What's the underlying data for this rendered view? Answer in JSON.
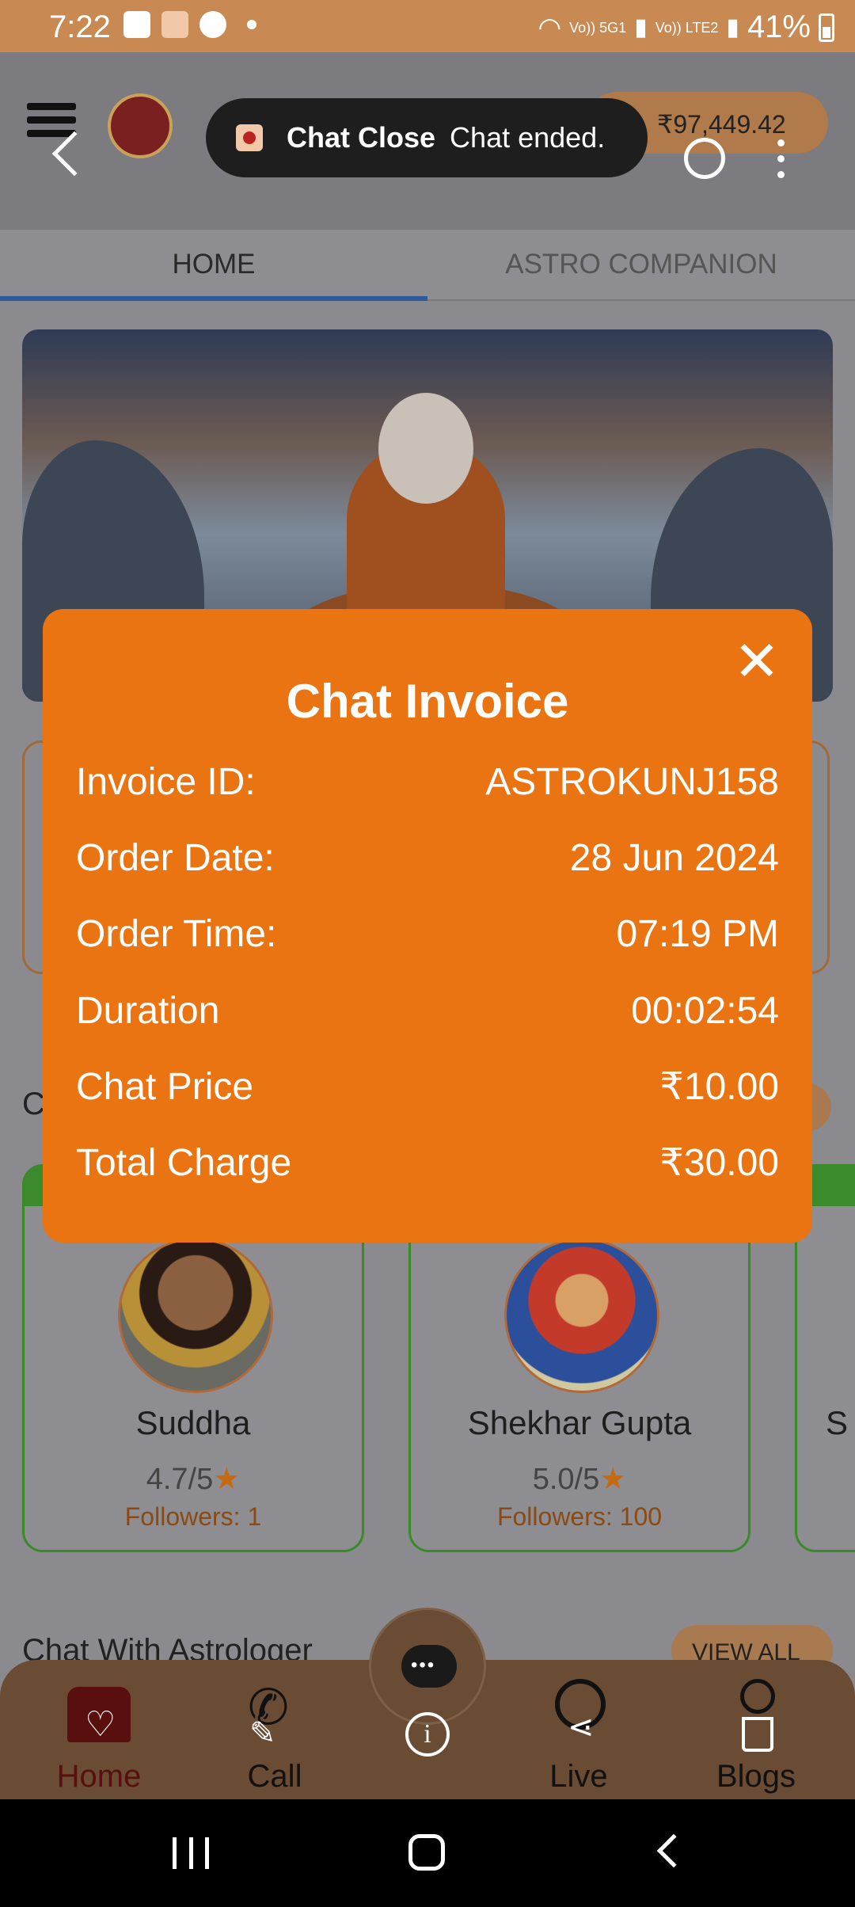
{
  "status_bar": {
    "time": "7:22",
    "network_1": "Vo)) 5G1",
    "network_2": "Vo)) LTE2",
    "battery": "41%"
  },
  "app_bar": {
    "wallet_balance": "₹97,449.42"
  },
  "toast": {
    "title": "Chat Close",
    "message": "Chat ended."
  },
  "tabs": [
    {
      "label": "HOME",
      "active": true
    },
    {
      "label": "ASTRO COMPANION",
      "active": false
    }
  ],
  "sections": {
    "first_partial": "C",
    "second": "Chat With Astrologer",
    "view_all": "VIEW ALL"
  },
  "astrologers": [
    {
      "name": "Suddha",
      "rating": "4.7/5",
      "followers": "Followers: 1"
    },
    {
      "name": "Shekhar Gupta",
      "rating": "5.0/5",
      "followers": "Followers: 100"
    },
    {
      "name": "S",
      "rating": "",
      "followers": ""
    }
  ],
  "invoice": {
    "title": "Chat Invoice",
    "close_glyph": "✕",
    "rows": [
      {
        "label": "Invoice ID:",
        "value": "ASTROKUNJ158"
      },
      {
        "label": "Order Date:",
        "value": "28 Jun 2024"
      },
      {
        "label": "Order Time:",
        "value": "07:19 PM"
      },
      {
        "label": "Duration",
        "value": "00:02:54"
      },
      {
        "label": "Chat Price",
        "value": "₹10.00"
      },
      {
        "label": "Total Charge",
        "value": "₹30.00"
      }
    ]
  },
  "bottom_nav": [
    {
      "label": "Home",
      "icon": "home-heart-icon"
    },
    {
      "label": "Call",
      "icon": "phone-edit-icon"
    },
    {
      "label": "",
      "icon": "info-icon"
    },
    {
      "label": "Live",
      "icon": "live-share-icon"
    },
    {
      "label": "Blogs",
      "icon": "blogs-delete-icon"
    }
  ],
  "colors": {
    "accent_orange": "#ea7312",
    "nav_brown": "#6a4c34",
    "status_bar": "#c88a52",
    "card_green": "#3a8a2a"
  }
}
